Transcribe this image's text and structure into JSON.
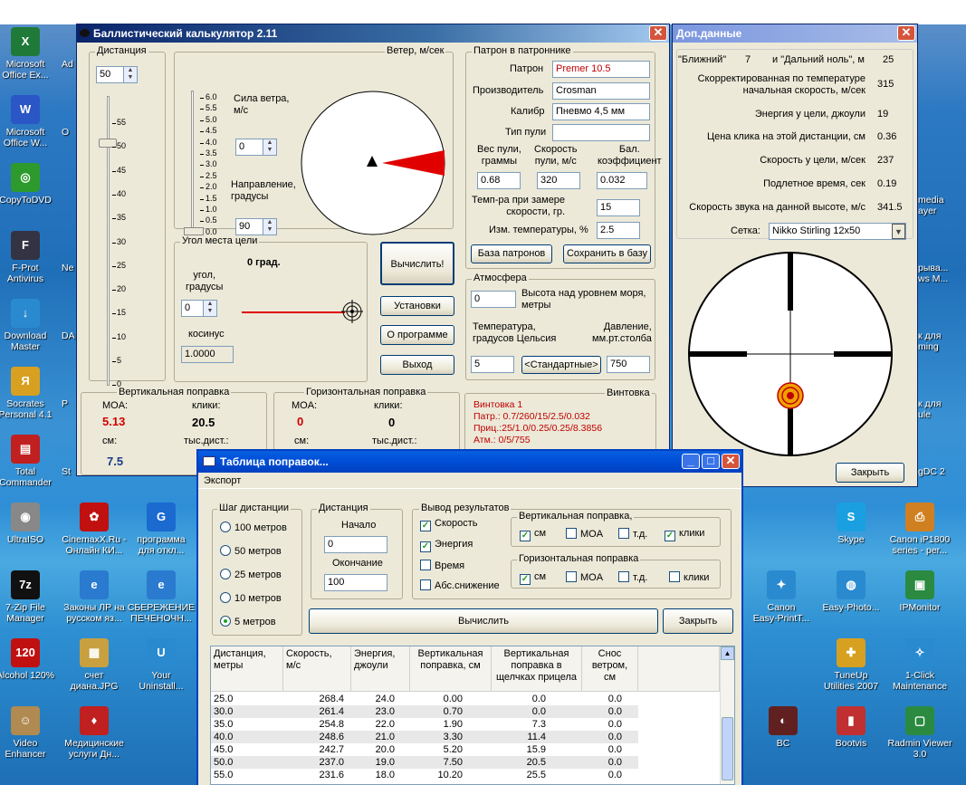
{
  "desktop": {
    "left_icons": [
      {
        "label": "Microsoft\nOffice Ex...",
        "icon": "excel-icon",
        "color": "#1f7a3a",
        "glyph": "X"
      },
      {
        "label": "Microsoft\nOffice W...",
        "icon": "word-icon",
        "color": "#2a56c6",
        "glyph": "W"
      },
      {
        "label": "CopyToDVD",
        "icon": "copytodvd-icon",
        "color": "#2c9a2c",
        "glyph": "◎"
      },
      {
        "label": "F-Prot\nAntivirus",
        "icon": "fprot-icon",
        "color": "#334",
        "glyph": "F"
      },
      {
        "label": "Download\nMaster",
        "icon": "download-master-icon",
        "color": "#2a8ad0",
        "glyph": "↓"
      },
      {
        "label": "Socrates\nPersonal 4.1",
        "icon": "socrates-icon",
        "color": "#d8a020",
        "glyph": "Я"
      },
      {
        "label": "Total\nCommander",
        "icon": "total-commander-icon",
        "color": "#c02020",
        "glyph": "▤"
      },
      {
        "label": "UltraISO",
        "icon": "ultraiso-icon",
        "color": "#888",
        "glyph": "◉"
      },
      {
        "label": "7-Zip File\nManager",
        "icon": "7zip-icon",
        "color": "#111",
        "glyph": "7z"
      },
      {
        "label": "Alcohol 120%",
        "icon": "alcohol-icon",
        "color": "#c01010",
        "glyph": "120"
      },
      {
        "label": "Video\nEnhancer",
        "icon": "video-enhancer-icon",
        "color": "#b08a50",
        "glyph": "☺"
      }
    ],
    "left2_labels": [
      "Ad",
      "O",
      "",
      "Ne",
      "DA",
      "P",
      "St"
    ],
    "mid_icons": [
      {
        "label": "CinemaxX.Ru -\nОнлайн КИ...",
        "icon": "cinemax-icon",
        "color": "#c01010",
        "glyph": "✿"
      },
      {
        "label": "программа\nдля откл...",
        "icon": "program-icon",
        "color": "#1a6ad0",
        "glyph": "G"
      },
      {
        "label": "Законы ЛР на\nрусском яз...",
        "icon": "ie-icon-1",
        "color": "#2a7ad0",
        "glyph": "e"
      },
      {
        "label": "СБЕРЕЖЕНИЕ\nПЕЧЕНОЧН...",
        "icon": "ie-icon-2",
        "color": "#2a7ad0",
        "glyph": "e"
      },
      {
        "label": "счет\nдиана.JPG",
        "icon": "jpg-icon",
        "color": "#c8a040",
        "glyph": "▦"
      },
      {
        "label": "Your\nUninstall...",
        "icon": "uninstaller-icon",
        "color": "#2a8ad0",
        "glyph": "U"
      },
      {
        "label": "Медицинские\nуслуги Дн...",
        "icon": "medical-icon",
        "color": "#c02020",
        "glyph": "♦"
      }
    ],
    "right_icons": [
      {
        "label": "Skype",
        "icon": "skype-icon",
        "color": "#1aa0e0",
        "glyph": "S"
      },
      {
        "label": "Canon iP1800\nseries - per...",
        "icon": "canon-printer-icon",
        "color": "#d08020",
        "glyph": "⎙"
      },
      {
        "label": "Canon\nEasy-PrintT...",
        "icon": "canon-easyprint-icon",
        "color": "#2a8ad0",
        "glyph": "✦"
      },
      {
        "label": "Easy-Photo...",
        "icon": "easyphoto-icon",
        "color": "#2a8ad0",
        "glyph": "◍"
      },
      {
        "label": "IPMonitor",
        "icon": "ipmonitor-icon",
        "color": "#2a8a40",
        "glyph": "▣"
      },
      {
        "label": "TuneUp\nUtilities 2007",
        "icon": "tuneup-icon",
        "color": "#d8a020",
        "glyph": "✚"
      },
      {
        "label": "1-Click\nMaintenance",
        "icon": "oneclick-icon",
        "color": "#2a8ad0",
        "glyph": "✧"
      },
      {
        "label": "BC",
        "icon": "bc-icon",
        "color": "#602020",
        "glyph": "◐"
      },
      {
        "label": "Bootvis",
        "icon": "bootvis-icon",
        "color": "#c03030",
        "glyph": "▮"
      },
      {
        "label": "Radmin Viewer\n3.0",
        "icon": "radmin-icon",
        "color": "#2a8a40",
        "glyph": "▢"
      }
    ],
    "partial_right": [
      "media\nayer",
      "рыва...\nws M...",
      "к для\nming",
      "к для\nule",
      "gDC 2"
    ]
  },
  "main": {
    "title": "Баллистический калькулятор 2.11",
    "distance_label": "Дистанция",
    "distance_value": "50",
    "distance_ticks": [
      "55",
      "50",
      "45",
      "40",
      "35",
      "30",
      "25",
      "20",
      "15",
      "10",
      "5",
      "0"
    ],
    "wind_group": "Ветер, м/сек",
    "wind_ticks": [
      "6.0",
      "5.5",
      "5.0",
      "4.5",
      "4.0",
      "3.5",
      "3.0",
      "2.5",
      "2.0",
      "1.5",
      "1.0",
      "0.5",
      "0.0"
    ],
    "wind_speed_label": "Сила ветра,\nм/с",
    "wind_speed_value": "0",
    "wind_dir_label": "Направление,\nградусы",
    "wind_dir_value": "90",
    "angle_group": "Угол места цели",
    "angle_title": "0 град.",
    "angle_label": "угол,\nградусы",
    "angle_value": "0",
    "cos_label": "косинус",
    "cos_value": "1.0000",
    "btn_calc": "Вычислить!",
    "btn_settings": "Установки",
    "btn_about": "О программе",
    "btn_exit": "Выход",
    "cart_group": "Патрон в патроннике",
    "cart_label": "Патрон",
    "cart_value": "Premer 10.5",
    "maker_label": "Производитель",
    "maker_value": "Crosman",
    "caliber_label": "Калибр",
    "caliber_value": "Пневмо 4,5 мм",
    "bullet_type_label": "Тип пули",
    "bullet_type_value": "",
    "weight_label": "Вес пули,\nграммы",
    "weight_value": "0.68",
    "speed_label": "Скорость\nпули, м/с",
    "speed_value": "320",
    "bc_label": "Бал.\nкоэффициент",
    "bc_value": "0.032",
    "temp_meas_label": "Темп-ра при замере\nскорости, гр.",
    "temp_meas_value": "15",
    "temp_change_label": "Изм. температуры, %",
    "temp_change_value": "2.5",
    "btn_ammo_db": "База патронов",
    "btn_save_db": "Сохранить в базу",
    "atm_group": "Атмосфера",
    "alt_value": "0",
    "alt_label": "Высота над уровнем моря,\nметры",
    "temp_label": "Температура,\nградусов Цельсия",
    "pressure_label": "Давление,\nмм.рт.столба",
    "temp_value": "5",
    "btn_standard": "<Стандартные>",
    "pressure_value": "750",
    "vert_group": "Вертикальная поправка",
    "vert_moa_label": "MOA:",
    "vert_moa_value": "5.13",
    "vert_clicks_label": "клики:",
    "vert_clicks_value": "20.5",
    "vert_cm_label": "см:",
    "vert_cm_value": "7.5",
    "vert_thous_label": "тыс.дист.:",
    "horiz_group": "Горизонтальная поправка",
    "horiz_moa_label": "MOA:",
    "horiz_moa_value": "0",
    "horiz_clicks_label": "клики:",
    "horiz_clicks_value": "0",
    "horiz_cm_label": "см:",
    "horiz_thous_label": "тыс.дист.:",
    "rifle_group": "Винтовка",
    "rifle_lines": [
      "Винтовка 1",
      "Патр.: 0.7/260/15/2.5/0.032",
      "Приц.:25/1.0/0.25/0.25/8.3856",
      "Атм.: 0/5/755"
    ]
  },
  "extra": {
    "title": "Доп.данные",
    "near_label": "\"Ближний\"",
    "near_value": "7",
    "far_label": "и \"Дальний ноль\", м",
    "far_value": "25",
    "rows": [
      {
        "label": "Скорректированная по температуре\nначальная скорость, м/сек",
        "value": "315"
      },
      {
        "label": "Энергия у цели, джоули",
        "value": "19"
      },
      {
        "label": "Цена клика на этой дистанции, см",
        "value": "0.36"
      },
      {
        "label": "Скорость у цели, м/сек",
        "value": "237"
      },
      {
        "label": "Подлетное время, сек",
        "value": "0.19"
      },
      {
        "label": "Скорость звука на данной высоте, м/с",
        "value": "341.5"
      }
    ],
    "reticle_label": "Сетка:",
    "reticle_value": "Nikko Stirling 12x50",
    "btn_close": "Закрыть"
  },
  "table_win": {
    "title": "Таблица поправок...",
    "menu_export": "Экспорт",
    "step_group": "Шаг дистанции",
    "steps": [
      {
        "label": "100 метров",
        "on": false
      },
      {
        "label": "50 метров",
        "on": false
      },
      {
        "label": "25 метров",
        "on": false
      },
      {
        "label": "10 метров",
        "on": false
      },
      {
        "label": "5 метров",
        "on": true
      }
    ],
    "dist_group": "Дистанция",
    "start_label": "Начало",
    "start_value": "0",
    "end_label": "Окончание",
    "end_value": "100",
    "out_group": "Вывод результатов",
    "out_items": [
      {
        "label": "Скорость",
        "on": true
      },
      {
        "label": "Энергия",
        "on": true
      },
      {
        "label": "Время",
        "on": false
      },
      {
        "label": "Абс.снижение",
        "on": false
      }
    ],
    "vert_group": "Вертикальная поправка,",
    "vert_items": [
      {
        "label": "см",
        "on": true
      },
      {
        "label": "MOA",
        "on": false
      },
      {
        "label": "т.д.",
        "on": false
      },
      {
        "label": "клики",
        "on": true
      }
    ],
    "horiz_group": "Горизонтальная поправка",
    "horiz_items": [
      {
        "label": "см",
        "on": true
      },
      {
        "label": "MOA",
        "on": false
      },
      {
        "label": "т.д.",
        "on": false
      },
      {
        "label": "клики",
        "on": false
      }
    ],
    "btn_calc": "Вычислить",
    "btn_close": "Закрыть",
    "headers": [
      "Дистанция,\nметры",
      "Скорость,\nм/с",
      "Энергия,\nджоули",
      "Вертикальная\nпоправка, см",
      "Вертикальная\nпоправка в\nщелчках прицела",
      "Снос\nветром,\nсм"
    ],
    "rows": [
      [
        "25.0",
        "268.4",
        "24.0",
        "0.00",
        "0.0",
        "0.0"
      ],
      [
        "30.0",
        "261.4",
        "23.0",
        "0.70",
        "0.0",
        "0.0"
      ],
      [
        "35.0",
        "254.8",
        "22.0",
        "1.90",
        "7.3",
        "0.0"
      ],
      [
        "40.0",
        "248.6",
        "21.0",
        "3.30",
        "11.4",
        "0.0"
      ],
      [
        "45.0",
        "242.7",
        "20.0",
        "5.20",
        "15.9",
        "0.0"
      ],
      [
        "50.0",
        "237.0",
        "19.0",
        "7.50",
        "20.5",
        "0.0"
      ],
      [
        "55.0",
        "231.6",
        "18.0",
        "10.20",
        "25.5",
        "0.0"
      ]
    ]
  }
}
